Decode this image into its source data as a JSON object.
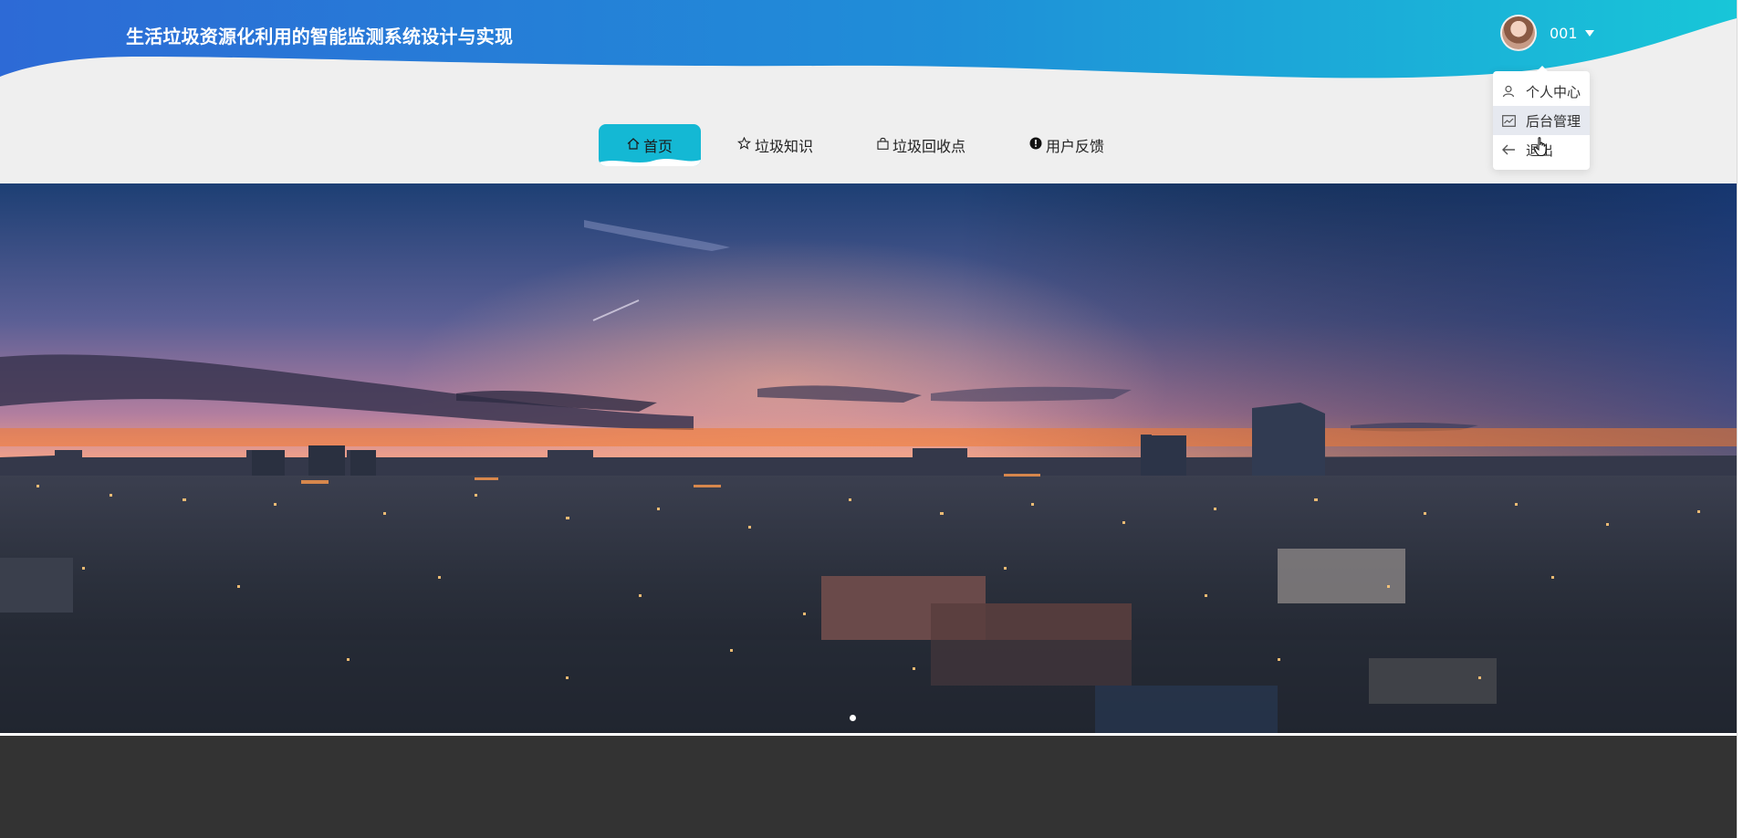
{
  "header": {
    "title": "生活垃圾资源化利用的智能监测系统设计与实现",
    "gradient_start": "#2f6fd6",
    "gradient_end": "#19c2d8"
  },
  "user": {
    "name": "001",
    "avatar_icon": "avatar-photo",
    "caret_icon": "caret-down-icon"
  },
  "user_menu": {
    "items": [
      {
        "label": "个人中心",
        "icon": "user-icon"
      },
      {
        "label": "后台管理",
        "icon": "dashboard-icon",
        "hovered": true
      },
      {
        "label": "退出",
        "icon": "logout-arrow-icon"
      }
    ]
  },
  "nav": {
    "active_color": "#14b8d4",
    "items": [
      {
        "label": "首页",
        "icon": "home-icon",
        "active": true
      },
      {
        "label": "垃圾知识",
        "icon": "star-icon"
      },
      {
        "label": "垃圾回收点",
        "icon": "bag-icon"
      },
      {
        "label": "用户反馈",
        "icon": "info-circle-icon"
      }
    ]
  },
  "banner": {
    "image": "city-skyline-at-dusk",
    "active_slide": 1,
    "slide_count": 1
  },
  "footer": {
    "background": "#333333"
  }
}
